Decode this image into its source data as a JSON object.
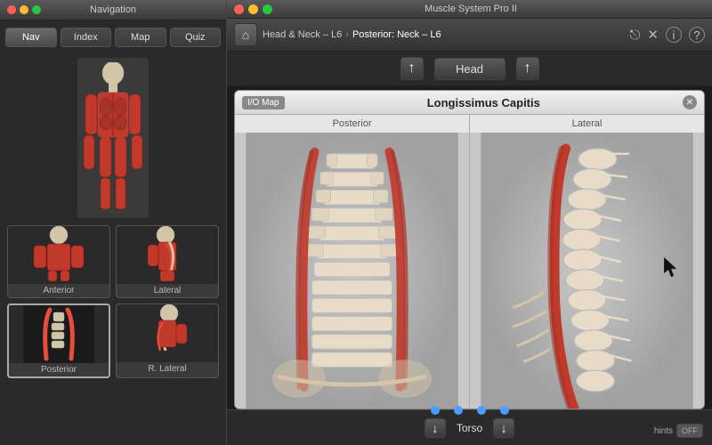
{
  "nav_window": {
    "title": "Navigation",
    "tabs": [
      {
        "label": "Nav",
        "active": true
      },
      {
        "label": "Index",
        "active": false
      },
      {
        "label": "Map",
        "active": false
      },
      {
        "label": "Quiz",
        "active": false
      }
    ]
  },
  "main_window": {
    "title": "Muscle System Pro II",
    "breadcrumb": {
      "parent": "Head & Neck – L6",
      "current": "Posterior: Neck – L6"
    },
    "head_nav": {
      "label": "Head",
      "up_arrow": "↑",
      "right_arrow": "↑"
    },
    "io_map": {
      "tag": "I/O Map",
      "title": "Longissimus Capitis",
      "views": [
        {
          "label": "Posterior"
        },
        {
          "label": "Lateral"
        }
      ]
    },
    "torso_nav": {
      "label": "Torso",
      "down_arrow": "↓",
      "right_arrow": "↓"
    },
    "hints": {
      "label": "hints",
      "toggle": "OFF"
    }
  },
  "thumbnails": [
    {
      "label": "Anterior",
      "active": false
    },
    {
      "label": "Lateral",
      "active": false
    },
    {
      "label": "Posterior",
      "active": true
    },
    {
      "label": "R. Lateral",
      "active": false
    }
  ],
  "icons": {
    "home": "⌂",
    "share": "⎋",
    "close_x": "✕",
    "info": "ⓘ",
    "help": "?",
    "close_circle": "✕"
  },
  "colors": {
    "accent_red": "#c0392b",
    "muscle_red": "#c0392b",
    "bone_color": "#d4c5a9",
    "panel_bg": "#2a2a2a",
    "active_tab": "#5a5a5a"
  }
}
